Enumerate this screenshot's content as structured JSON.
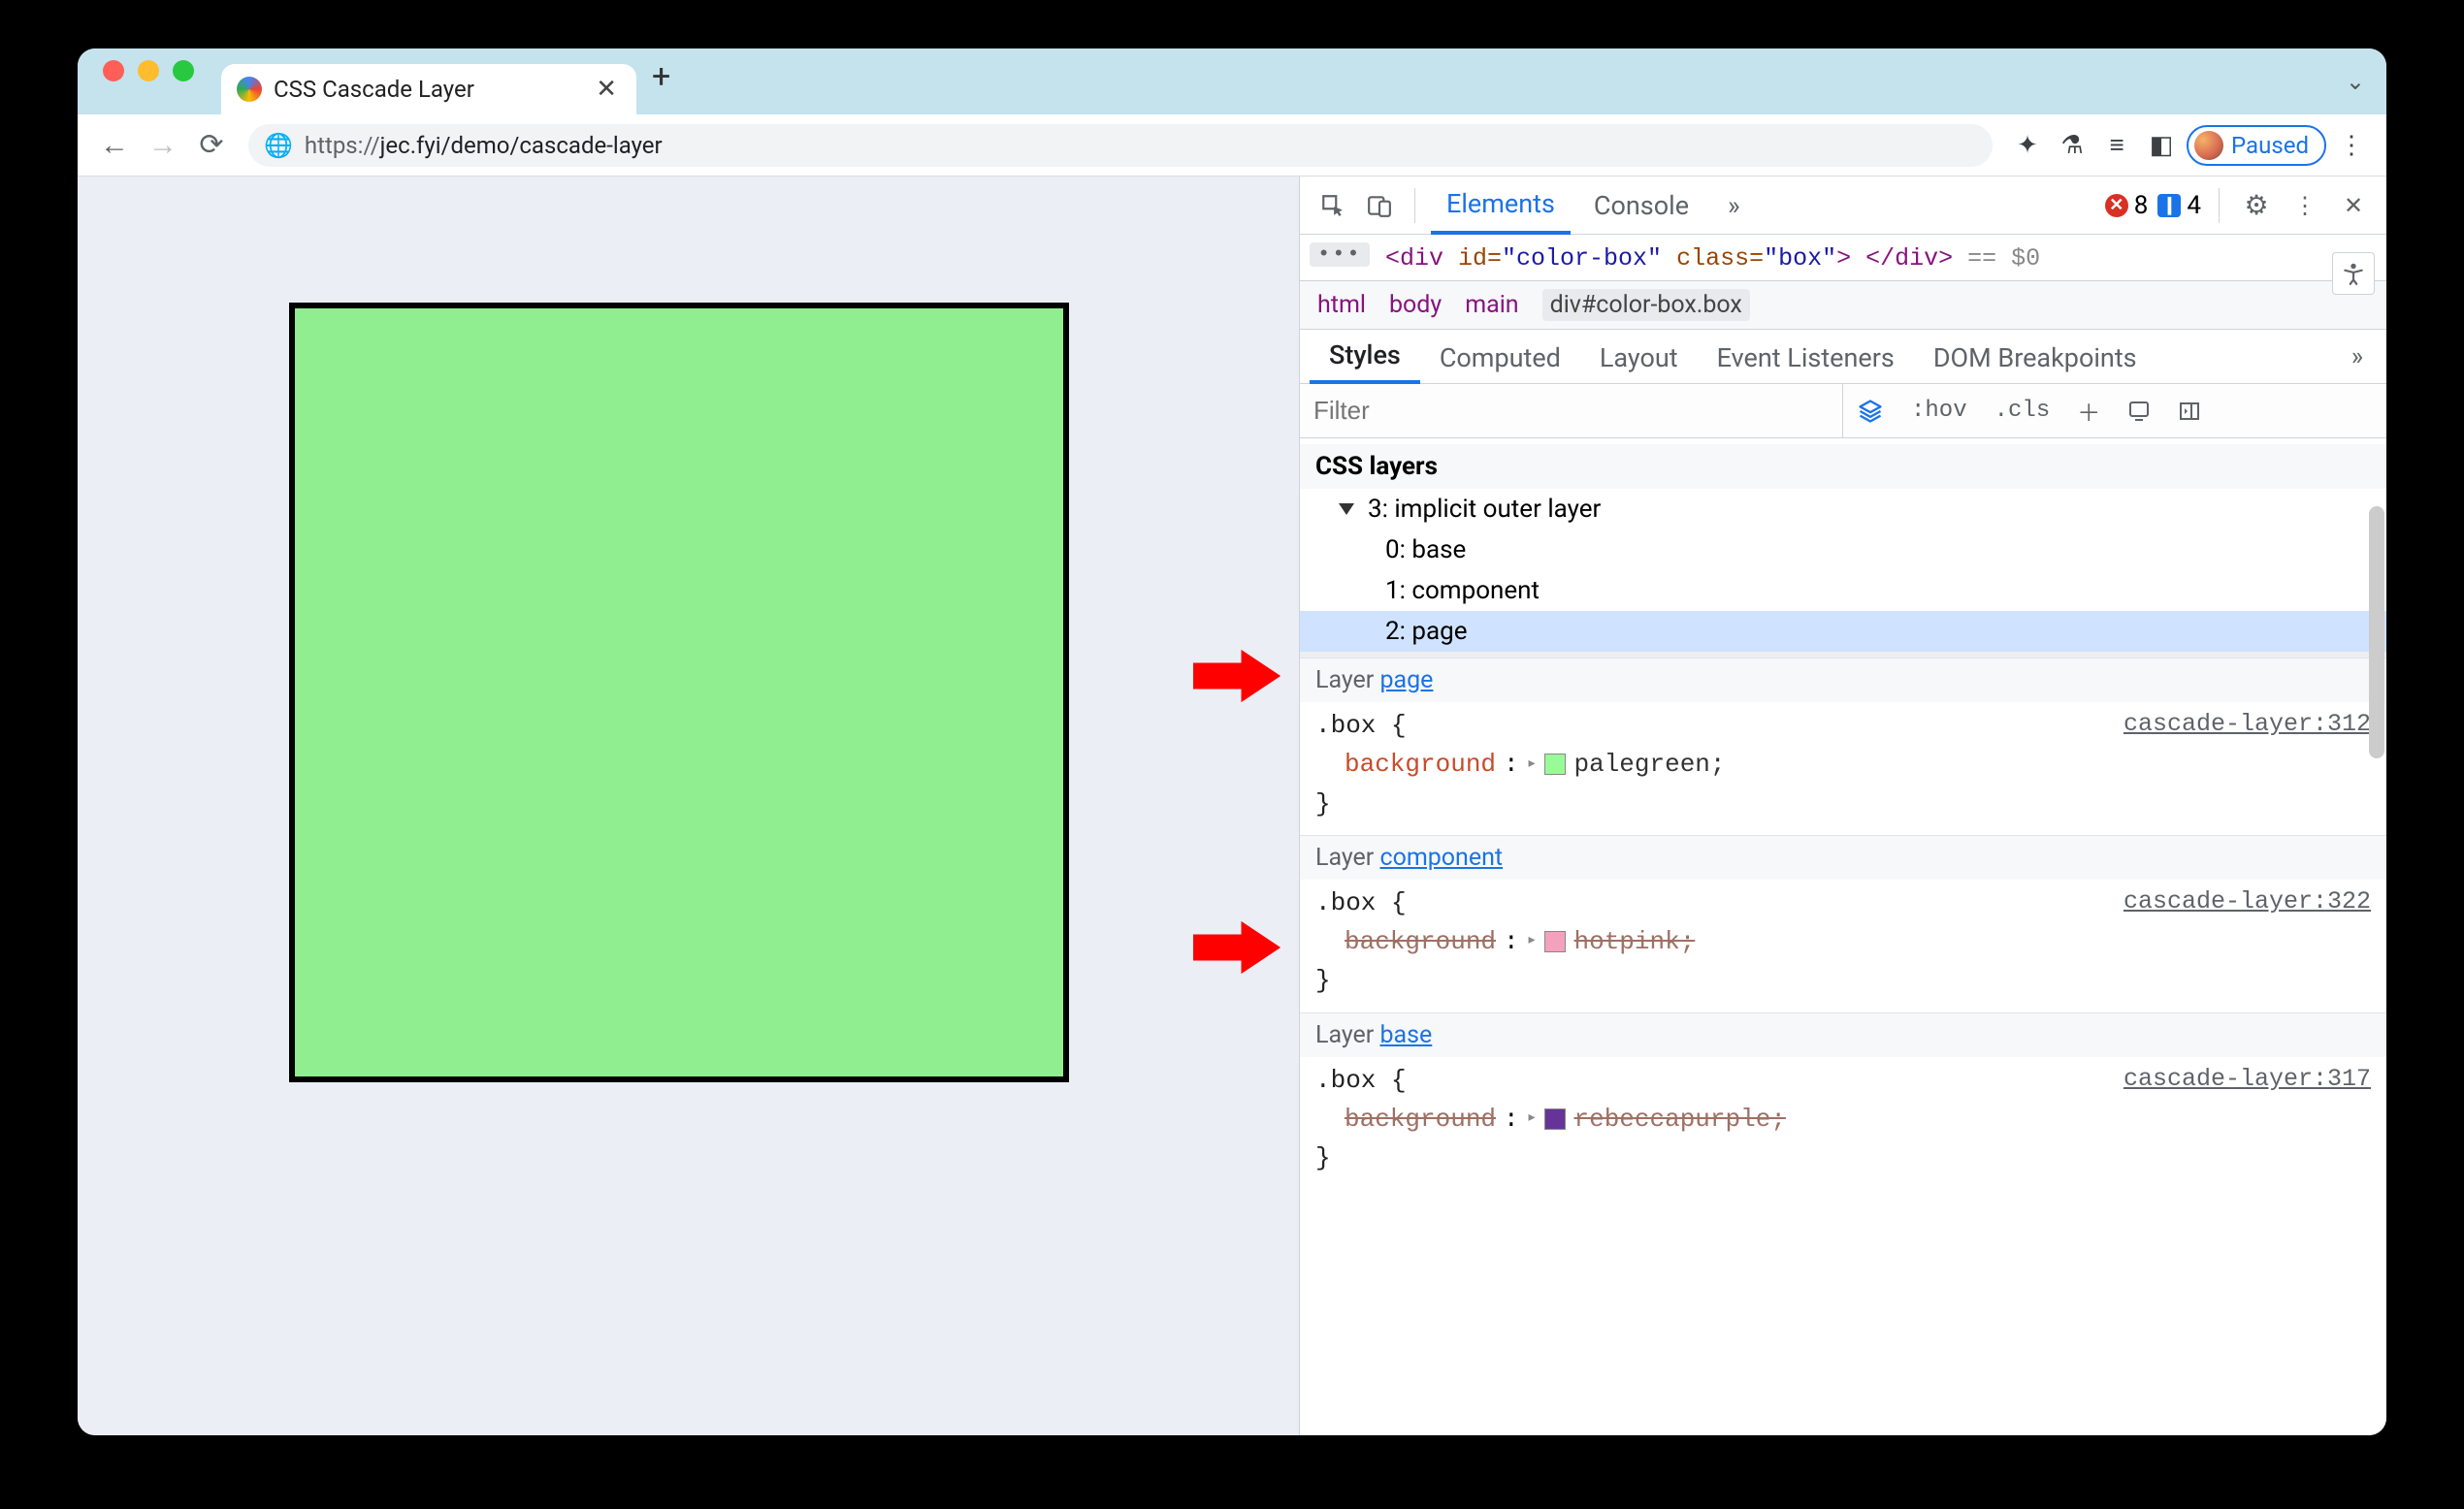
{
  "browser": {
    "tab_title": "CSS Cascade Layer",
    "url_scheme": "https://",
    "url_rest": "jec.fyi/demo/cascade-layer",
    "paused_label": "Paused"
  },
  "devtools": {
    "tabs": {
      "elements": "Elements",
      "console": "Console"
    },
    "errors_count": "8",
    "info_count": "4",
    "dom_line": {
      "tag_open": "<div",
      "attr_id": " id=",
      "val_id": "\"color-box\"",
      "attr_class": " class=",
      "val_class": "\"box\"",
      "tag_close": "> </div>",
      "suffix": " == $0"
    },
    "breadcrumb": [
      "html",
      "body",
      "main"
    ],
    "breadcrumb_selected": "div#color-box.box",
    "style_tabs": {
      "styles": "Styles",
      "computed": "Computed",
      "layout": "Layout",
      "listeners": "Event Listeners",
      "dom_bp": "DOM Breakpoints"
    },
    "filter_placeholder": "Filter",
    "hov": ":hov",
    "cls": ".cls",
    "layers_title": "CSS layers",
    "layer_tree": {
      "root": "3: implicit outer layer",
      "children": [
        "0: base",
        "1: component",
        "2: page"
      ]
    },
    "rules": [
      {
        "layer_prefix": "Layer ",
        "layer_name": "page",
        "selector": ".box",
        "source": "cascade-layer:312",
        "prop": "background",
        "value": "palegreen",
        "swatch": "sw-palegreen",
        "struck": false
      },
      {
        "layer_prefix": "Layer ",
        "layer_name": "component",
        "selector": ".box",
        "source": "cascade-layer:322",
        "prop": "background",
        "value": "hotpink",
        "swatch": "sw-hotpink",
        "struck": true
      },
      {
        "layer_prefix": "Layer ",
        "layer_name": "base",
        "selector": ".box",
        "source": "cascade-layer:317",
        "prop": "background",
        "value": "rebeccapurple",
        "swatch": "sw-rebecca",
        "struck": true
      }
    ]
  }
}
